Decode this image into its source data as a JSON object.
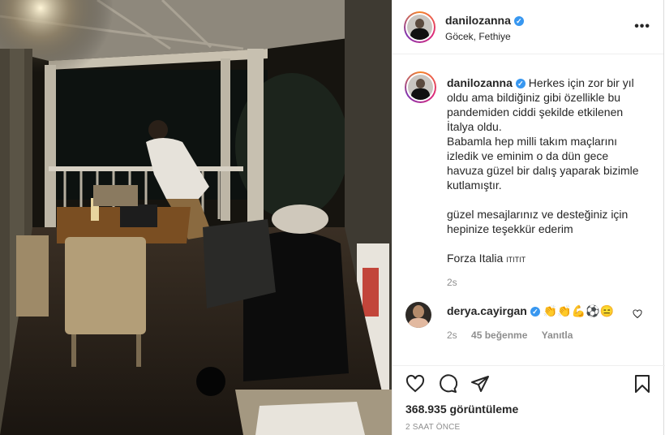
{
  "header": {
    "username": "danilozanna",
    "location": "Göcek, Fethiye"
  },
  "caption": {
    "username": "danilozanna",
    "text_first": "Herkes için zor bir yıl oldu ama bildiğiniz gibi özellikle bu pandemiden ciddi şekilde etkilenen İtalya oldu.",
    "text_second": "Babamla hep milli takım maçlarını izledik ve eminim o da dün gece havuza güzel bir dalış yaparak bizimle kutlamıştır.",
    "text_third": "güzel mesajlarınız ve desteğiniz için hepinize teşekkür ederim",
    "text_fourth": "Forza Italia",
    "flags": "ITITIT",
    "time": "2s"
  },
  "comment": {
    "username": "derya.cayirgan",
    "text": "👏👏💪⚽😑",
    "time": "2s",
    "likes": "45 beğenme",
    "reply": "Yanıtla"
  },
  "footer": {
    "views": "368.935 görüntüleme",
    "ago": "2 SAAT ÖNCE"
  },
  "icons": {
    "verified": "verified-badge-icon",
    "more": "more-options-icon",
    "like": "heart-icon",
    "comment": "comment-bubble-icon",
    "share": "paper-plane-icon",
    "save": "bookmark-icon"
  },
  "colors": {
    "verified": "#3897f0",
    "secondary_text": "#8e8e8e",
    "text": "#262626"
  }
}
